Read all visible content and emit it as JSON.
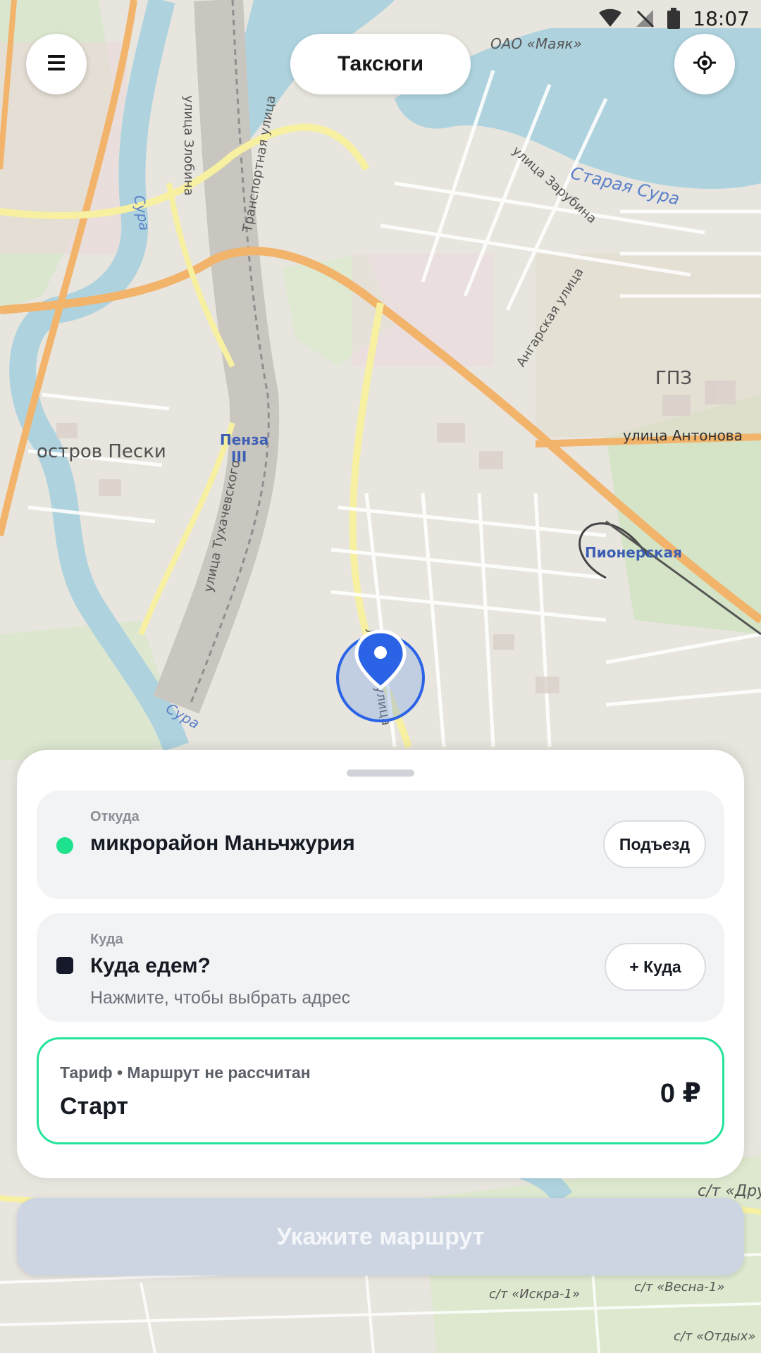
{
  "status_bar": {
    "time": "18:07"
  },
  "header": {
    "title": "Таксюги",
    "menu_icon": "hamburger-icon",
    "locate_icon": "crosshair-icon"
  },
  "map_labels": {
    "ostrov": "остров Пески",
    "penza": "Пенза",
    "penza_num": "III",
    "pioner": "Пионерская",
    "antonova": "улица Антонова",
    "gpz": "ГПЗ",
    "staraya_sura": "Старая Сура",
    "sura1": "Сура",
    "sura2": "Сура",
    "mayak": "ОАО «Маяк»",
    "zarubina": "улица Зарубина",
    "angarskaya": "Ангарская улица",
    "zlobina": "улица Злобина",
    "transport": "Транспортная улица",
    "tuhach": "улица Тухачевского",
    "lugovaya": "Луговая улица",
    "st_dru": "с/т «Дру",
    "st_iskra": "с/т «Искра-1»",
    "st_vesna": "с/т «Весна-1»",
    "st_otdyh": "с/т «Отдых»"
  },
  "sheet": {
    "from": {
      "label": "Откуда",
      "value": "микрорайон Маньчжурия",
      "button": "Подъезд"
    },
    "to": {
      "label": "Куда",
      "value": "Куда едем?",
      "hint": "Нажмите, чтобы выбрать адрес",
      "button": "+ Куда"
    },
    "tariff": {
      "subtitle": "Тариф • Маршрут не рассчитан",
      "name": "Старт",
      "price": "0 ₽"
    }
  },
  "cta": {
    "label": "Укажите маршрут"
  },
  "colors": {
    "accent": "#23e39a",
    "pin": "#2a63e6",
    "cta_disabled": "#cdd5e2"
  }
}
